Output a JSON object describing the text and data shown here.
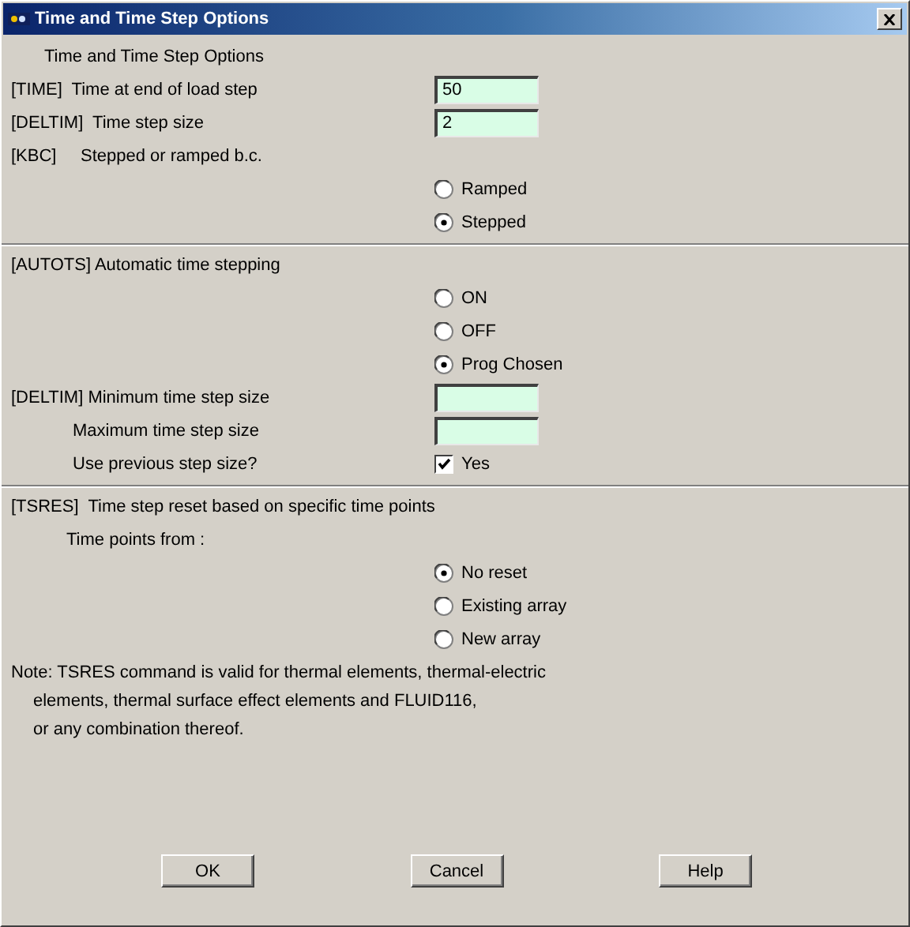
{
  "window": {
    "title": "Time and Time Step Options"
  },
  "sections": [
    {
      "rows": [
        {
          "kind": "caption",
          "label": "Time and Time Step Options"
        },
        {
          "kind": "field",
          "label": "[TIME]  Time at end of load step",
          "value": "50"
        },
        {
          "kind": "field",
          "label": "[DELTIM]  Time step size",
          "value": "2"
        },
        {
          "kind": "label",
          "label": "[KBC]     Stepped or ramped b.c."
        },
        {
          "kind": "radio",
          "label": "Ramped",
          "selected": false
        },
        {
          "kind": "radio",
          "label": "Stepped",
          "selected": true
        }
      ]
    },
    {
      "rows": [
        {
          "kind": "label",
          "label": "[AUTOTS] Automatic time stepping"
        },
        {
          "kind": "radio",
          "label": "ON",
          "selected": false
        },
        {
          "kind": "radio",
          "label": "OFF",
          "selected": false
        },
        {
          "kind": "radio",
          "label": "Prog Chosen",
          "selected": true
        },
        {
          "kind": "field",
          "label": "[DELTIM] Minimum time step size"
        },
        {
          "kind": "field",
          "label": "Maximum time step size",
          "indented": true
        },
        {
          "kind": "check",
          "label": "Use previous step size?",
          "indented": true,
          "option": "Yes",
          "checked": true
        }
      ]
    },
    {
      "rows": [
        {
          "kind": "label",
          "label": "[TSRES]  Time step reset based on specific time points"
        },
        {
          "kind": "caption",
          "label": "Time points from :"
        },
        {
          "kind": "radio",
          "label": "No reset",
          "selected": true
        },
        {
          "kind": "radio",
          "label": "Existing array",
          "selected": false
        },
        {
          "kind": "radio",
          "label": "New array",
          "selected": false
        },
        {
          "kind": "note",
          "lines": [
            "Note: TSRES command is valid for thermal elements, thermal-electric",
            "elements, thermal surface effect elements and FLUID116,",
            "or any combination thereof."
          ]
        }
      ]
    }
  ],
  "buttons": [
    "OK",
    "Cancel",
    "Help"
  ]
}
